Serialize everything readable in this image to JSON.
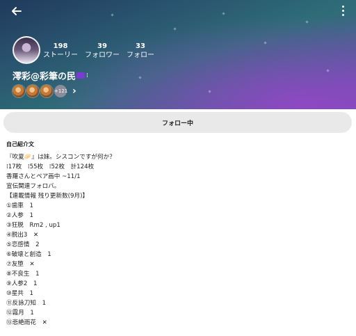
{
  "profile": {
    "name": "澪彩@彩筆の民",
    "name_suffix": "⁞",
    "stats": [
      {
        "value": "198",
        "label": "ストーリー"
      },
      {
        "value": "39",
        "label": "フォロワー"
      },
      {
        "value": "33",
        "label": "フォロー"
      }
    ],
    "badge_more": "+121"
  },
  "follow_button": {
    "label": "フォロー中"
  },
  "bio": {
    "heading": "自己紹介文",
    "lines": [
      "『吹夏🥟』は妹。シスコンですが何か？",
      "⁞17枚　⁞55枚　⁞52枚　計124枚",
      "香羅さんとペア画中 ~11/1",
      "宣伝関連フォロバ。",
      "【連載情報 残り更新数(9月)】",
      "①歯車　1",
      "②人参　1",
      "③狂脱　Rm2 , up1",
      "④脱出3　✕",
      "⑤恋感情　2",
      "⑥破壊と創造　1",
      "⑦友堕　✕",
      "⑧不良生　1",
      "⑨人参2　1",
      "⑩星共　1",
      "⑪反詠刀知　1",
      "⑫霧月　1",
      "⑬悲絶雨花　✕"
    ]
  },
  "icons": {
    "back": "arrow-left-icon",
    "menu": "more-vert-icon",
    "chevron": "chevron-right-icon"
  }
}
